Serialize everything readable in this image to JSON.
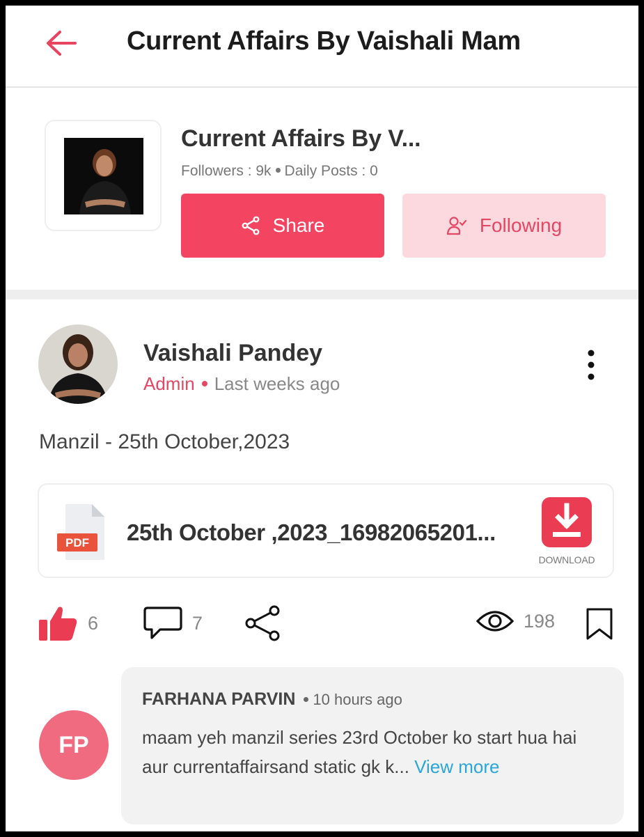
{
  "header": {
    "title": "Current Affairs By Vaishali Mam"
  },
  "channel": {
    "name": "Current Affairs By V...",
    "followers": "Followers : 9k",
    "daily_posts": "Daily Posts : 0",
    "share_label": "Share",
    "following_label": "Following"
  },
  "post": {
    "author": "Vaishali Pandey",
    "role": "Admin",
    "time": "Last weeks ago",
    "text": "Manzil - 25th October,2023",
    "attachment": {
      "type_label": "PDF",
      "filename": "25th October ,2023_16982065201...",
      "download_label": "DOWNLOAD"
    },
    "stats": {
      "likes": "6",
      "comments": "7",
      "views": "198"
    }
  },
  "comment": {
    "initials": "FP",
    "author": "FARHANA PARVIN",
    "time": "10 hours ago",
    "text": "maam yeh manzil series 23rd October ko start hua hai aur currentaffairsand static gk k...",
    "view_more": "View more"
  },
  "colors": {
    "accent": "#f34561",
    "accent_light": "#fcd9de",
    "link": "#2aa6d8"
  }
}
